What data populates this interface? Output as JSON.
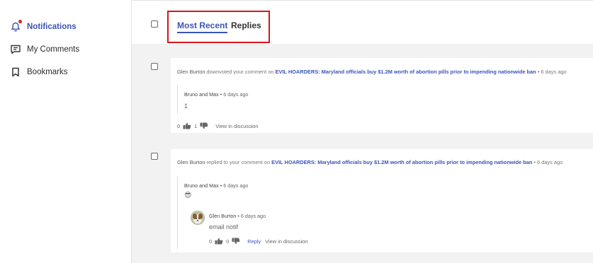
{
  "sidebar": {
    "items": [
      {
        "label": "Notifications",
        "icon": "bell-icon",
        "active": true
      },
      {
        "label": "My Comments",
        "icon": "comment-icon",
        "active": false
      },
      {
        "label": "Bookmarks",
        "icon": "bookmark-icon",
        "active": false
      }
    ]
  },
  "tabs": [
    {
      "label": "Most Recent",
      "active": true
    },
    {
      "label": "Replies",
      "active": false
    }
  ],
  "notifications": [
    {
      "actor": "Glen Burton",
      "action": "downvoted your comment on",
      "article": "EVIL HOARDERS: Maryland officials buy $1.2M worth of abortion pills prior to impending nationwide ban",
      "time": "• 6 days ago",
      "comment": {
        "author": "Bruno and Max",
        "time": "• 6 days ago",
        "text": "1",
        "upvotes": "0",
        "downvotes": "1",
        "view_label": "View in discussion"
      }
    },
    {
      "actor": "Glen Burton",
      "action": "replied to your comment on",
      "article": "EVIL HOARDERS: Maryland officials buy $1.2M worth of abortion pills prior to impending nationwide ban",
      "time": "• 6 days ago",
      "comment": {
        "author": "Bruno and Max",
        "time": "• 6 days ago",
        "text": "😎"
      },
      "reply": {
        "author": "Glen Burton",
        "time": "• 6 days ago",
        "text": "email notif",
        "upvotes": "0",
        "downvotes": "0",
        "reply_label": "Reply",
        "view_label": "View in discussion"
      }
    }
  ],
  "colors": {
    "accent": "#3a55b8",
    "highlight_box": "#d9141a",
    "badge": "#e0232c"
  }
}
